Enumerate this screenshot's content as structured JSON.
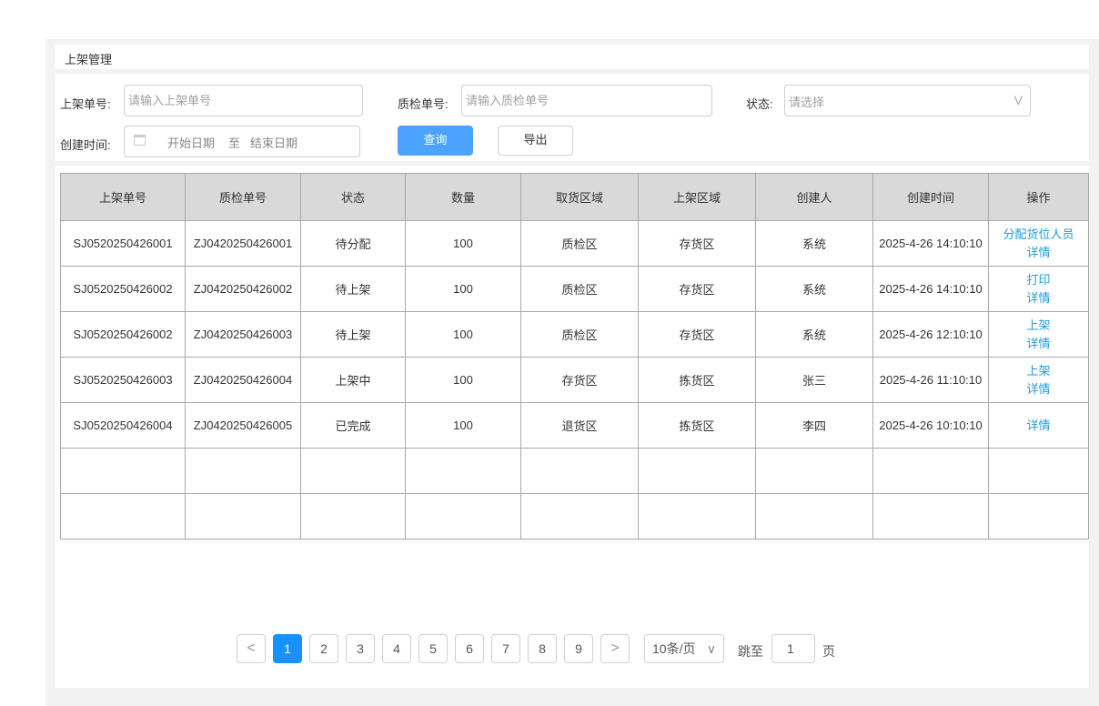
{
  "page": {
    "title": "上架管理"
  },
  "filters": {
    "putaway_no_label": "上架单号:",
    "putaway_no_placeholder": "请输入上架单号",
    "qc_no_label": "质检单号:",
    "qc_no_placeholder": "请输入质检单号",
    "status_label": "状态:",
    "status_placeholder": "请选择",
    "status_chevron": "V",
    "created_label": "创建时间:",
    "start_placeholder": "开始日期",
    "range_sep": "至",
    "end_placeholder": "结束日期",
    "query_button": "查询",
    "export_button": "导出"
  },
  "table": {
    "columns": [
      "上架单号",
      "质检单号",
      "状态",
      "数量",
      "取货区域",
      "上架区域",
      "创建人",
      "创建时间",
      "操作"
    ],
    "rows": [
      {
        "putaway_no": "SJ0520250426001",
        "qc_no": "ZJ0420250426001",
        "status": "待分配",
        "qty": "100",
        "pick_area": "质检区",
        "shelf_area": "存货区",
        "creator": "系统",
        "created": "2025-4-26 14:10:10",
        "actions": [
          "分配货位人员",
          "详情"
        ]
      },
      {
        "putaway_no": "SJ0520250426002",
        "qc_no": "ZJ0420250426002",
        "status": "待上架",
        "qty": "100",
        "pick_area": "质检区",
        "shelf_area": "存货区",
        "creator": "系统",
        "created": "2025-4-26 14:10:10",
        "actions": [
          "打印",
          "详情"
        ]
      },
      {
        "putaway_no": "SJ0520250426002",
        "qc_no": "ZJ0420250426003",
        "status": "待上架",
        "qty": "100",
        "pick_area": "质检区",
        "shelf_area": "存货区",
        "creator": "系统",
        "created": "2025-4-26 12:10:10",
        "actions": [
          "上架",
          "详情"
        ]
      },
      {
        "putaway_no": "SJ0520250426003",
        "qc_no": "ZJ0420250426004",
        "status": "上架中",
        "qty": "100",
        "pick_area": "存货区",
        "shelf_area": "拣货区",
        "creator": "张三",
        "created": "2025-4-26 11:10:10",
        "actions": [
          "上架",
          "详情"
        ]
      },
      {
        "putaway_no": "SJ0520250426004",
        "qc_no": "ZJ0420250426005",
        "status": "已完成",
        "qty": "100",
        "pick_area": "退货区",
        "shelf_area": "拣货区",
        "creator": "李四",
        "created": "2025-4-26 10:10:10",
        "actions": [
          "详情"
        ]
      }
    ],
    "empty_rows": 2
  },
  "pagination": {
    "prev": "<",
    "next": ">",
    "pages": [
      "1",
      "2",
      "3",
      "4",
      "5",
      "6",
      "7",
      "8",
      "9"
    ],
    "current": "1",
    "page_size": "10条/页",
    "page_size_chevron": "∨",
    "jump_label": "跳至",
    "jump_value": "1",
    "page_unit": "页"
  }
}
